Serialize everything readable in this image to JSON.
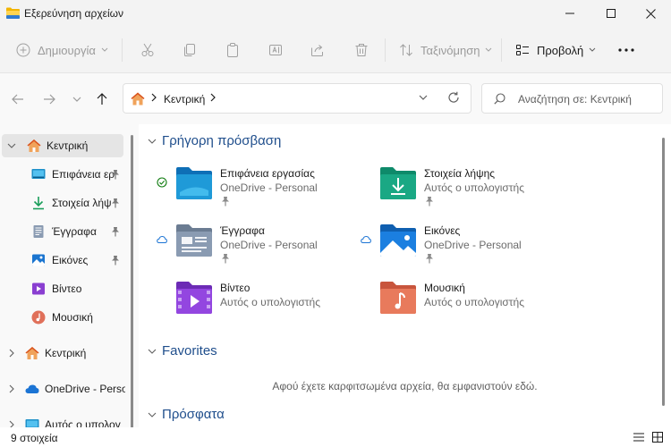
{
  "window": {
    "title": "Εξερεύνηση αρχείων"
  },
  "toolbar": {
    "new_label": "Δημιουργία",
    "sort_label": "Ταξινόμηση",
    "view_label": "Προβολή"
  },
  "address": {
    "crumb": "Κεντρική",
    "search_placeholder": "Αναζήτηση σε: Κεντρική"
  },
  "sidebar": {
    "items": [
      {
        "label": "Κεντρική",
        "icon": "home-icon"
      },
      {
        "label": "Επιφάνεια ερ",
        "icon": "desktop-icon",
        "pinned": true
      },
      {
        "label": "Στοιχεία λήψ",
        "icon": "download-icon",
        "pinned": true
      },
      {
        "label": "Έγγραφα",
        "icon": "documents-icon",
        "pinned": true
      },
      {
        "label": "Εικόνες",
        "icon": "pictures-icon",
        "pinned": true
      },
      {
        "label": "Βίντεο",
        "icon": "videos-icon"
      },
      {
        "label": "Μουσική",
        "icon": "music-icon"
      },
      {
        "label": "Κεντρική",
        "icon": "home-icon"
      },
      {
        "label": "OneDrive - Perso",
        "icon": "cloud-icon"
      },
      {
        "label": "Αυτός ο υπολογ",
        "icon": "pc-icon"
      }
    ]
  },
  "sections": {
    "quick_access": "Γρήγορη πρόσβαση",
    "favorites": "Favorites",
    "recent": "Πρόσφατα",
    "favorites_empty": "Αφού έχετε καρφιτσωμένα αρχεία, θα εμφανιστούν εδώ."
  },
  "quick_access": [
    {
      "name": "Επιφάνεια εργασίας",
      "sub": "OneDrive - Personal",
      "status": "synced",
      "icon": "desktop-folder-icon",
      "pinned": true
    },
    {
      "name": "Στοιχεία λήψης",
      "sub": "Αυτός ο υπολογιστής",
      "status": "",
      "icon": "downloads-folder-icon",
      "pinned": true
    },
    {
      "name": "Έγγραφα",
      "sub": "OneDrive - Personal",
      "status": "cloud",
      "icon": "documents-folder-icon",
      "pinned": true
    },
    {
      "name": "Εικόνες",
      "sub": "OneDrive - Personal",
      "status": "cloud",
      "icon": "pictures-folder-icon",
      "pinned": true
    },
    {
      "name": "Βίντεο",
      "sub": "Αυτός ο υπολογιστής",
      "status": "",
      "icon": "videos-folder-icon",
      "pinned": false
    },
    {
      "name": "Μουσική",
      "sub": "Αυτός ο υπολογιστής",
      "status": "",
      "icon": "music-folder-icon",
      "pinned": false
    }
  ],
  "status": {
    "count": "9 στοιχεία"
  },
  "colors": {
    "accent": "#0067c0",
    "section_title": "#1f4e8c",
    "sync_green": "#107c10"
  }
}
